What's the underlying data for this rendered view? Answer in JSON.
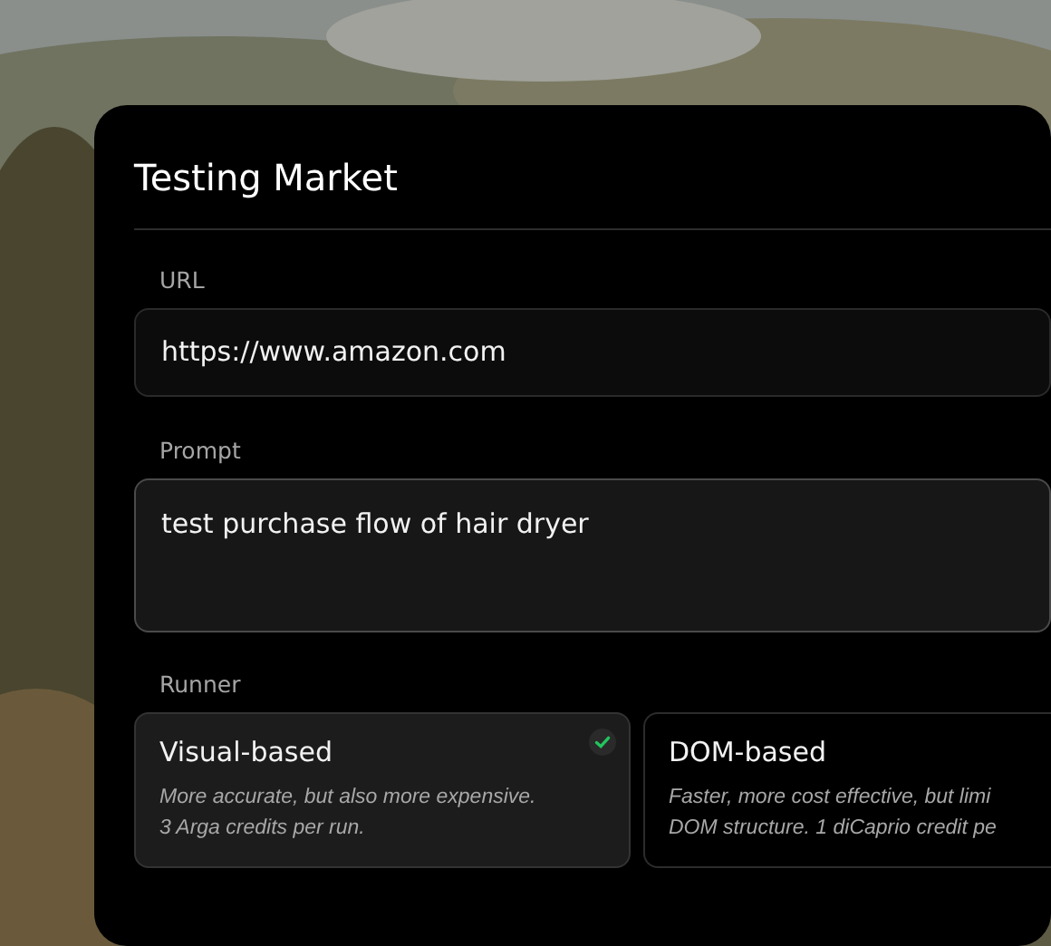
{
  "dialog": {
    "title": "Testing Market"
  },
  "fields": [
    {
      "kind": "input",
      "label": "URL",
      "value": "https://www.amazon.com"
    },
    {
      "kind": "textarea",
      "label": "Prompt",
      "value": "test purchase flow of hair dryer"
    }
  ],
  "runner": {
    "label": "Runner",
    "options": [
      {
        "title": "Visual-based",
        "description_lines": [
          "More accurate, but also more expensive.",
          "3 Arga credits per run."
        ],
        "selected": true
      },
      {
        "title": "DOM-based",
        "description_lines": [
          "Faster, more cost effective, but limi",
          "DOM structure. 1 diCaprio credit pe"
        ],
        "selected": false
      }
    ]
  }
}
